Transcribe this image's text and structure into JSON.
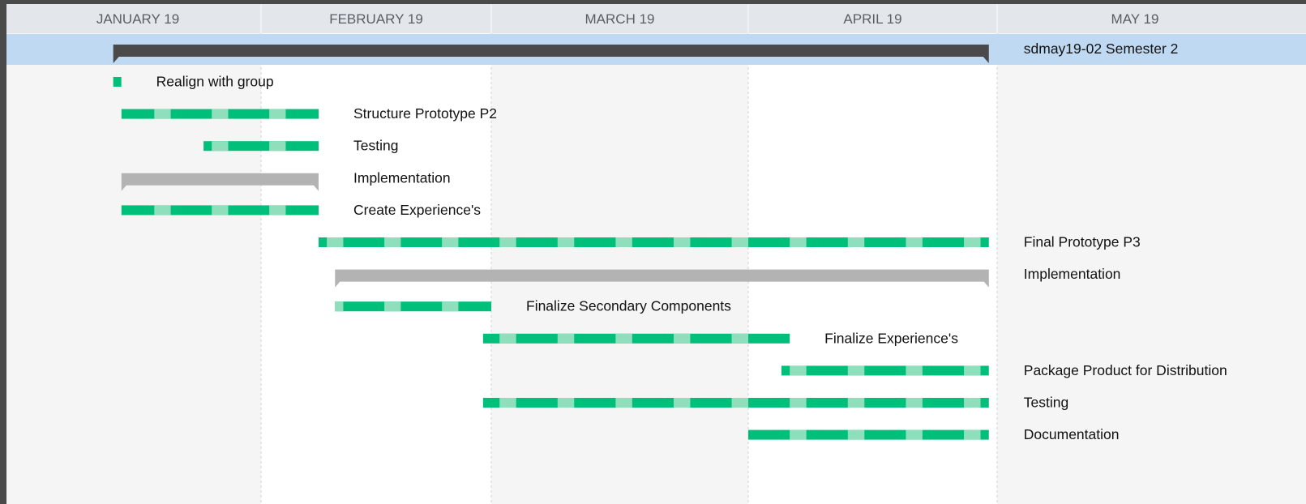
{
  "chart_data": {
    "type": "gantt",
    "timeline": {
      "months": [
        {
          "label": "JANUARY 19",
          "start": "2019-01-01"
        },
        {
          "label": "FEBRUARY 19",
          "start": "2019-02-01"
        },
        {
          "label": "MARCH 19",
          "start": "2019-03-01"
        },
        {
          "label": "APRIL 19",
          "start": "2019-04-01"
        },
        {
          "label": "MAY 19",
          "start": "2019-05-01"
        }
      ],
      "range": [
        "2019-01-01",
        "2019-05-31"
      ]
    },
    "project": {
      "label": "sdmay19-02 Semester 2",
      "start": "2019-01-14",
      "end": "2019-04-30"
    },
    "tasks": [
      {
        "label": "Realign with group",
        "start": "2019-01-14",
        "end": "2019-01-15",
        "kind": "task"
      },
      {
        "label": "Structure Prototype P2",
        "start": "2019-01-15",
        "end": "2019-02-08",
        "kind": "task"
      },
      {
        "label": "Testing",
        "start": "2019-01-25",
        "end": "2019-02-08",
        "kind": "task"
      },
      {
        "label": "Implementation",
        "start": "2019-01-15",
        "end": "2019-02-08",
        "kind": "group"
      },
      {
        "label": "Create Experience's",
        "start": "2019-01-15",
        "end": "2019-02-08",
        "kind": "task"
      },
      {
        "label": "Final Prototype P3",
        "start": "2019-02-08",
        "end": "2019-04-30",
        "kind": "task"
      },
      {
        "label": "Implementation",
        "start": "2019-02-10",
        "end": "2019-04-30",
        "kind": "group"
      },
      {
        "label": "Finalize Secondary Components",
        "start": "2019-02-10",
        "end": "2019-03-01",
        "kind": "task"
      },
      {
        "label": "Finalize Experience's",
        "start": "2019-02-28",
        "end": "2019-04-06",
        "kind": "task"
      },
      {
        "label": "Package Product for Distribution",
        "start": "2019-04-05",
        "end": "2019-04-30",
        "kind": "task"
      },
      {
        "label": "Testing",
        "start": "2019-02-28",
        "end": "2019-04-30",
        "kind": "task"
      },
      {
        "label": "Documentation",
        "start": "2019-04-01",
        "end": "2019-04-30",
        "kind": "task"
      }
    ],
    "colors": {
      "task": "#00bf7a",
      "task_light": "#8fdfbd",
      "group": "#b3b3b3",
      "project_bar": "#4a4a4a",
      "header_bg": "#e3e6ea",
      "project_row_bg": "#bfd9f2",
      "canvas": "#f5f5f5",
      "canvas_alt": "#ffffff"
    }
  }
}
